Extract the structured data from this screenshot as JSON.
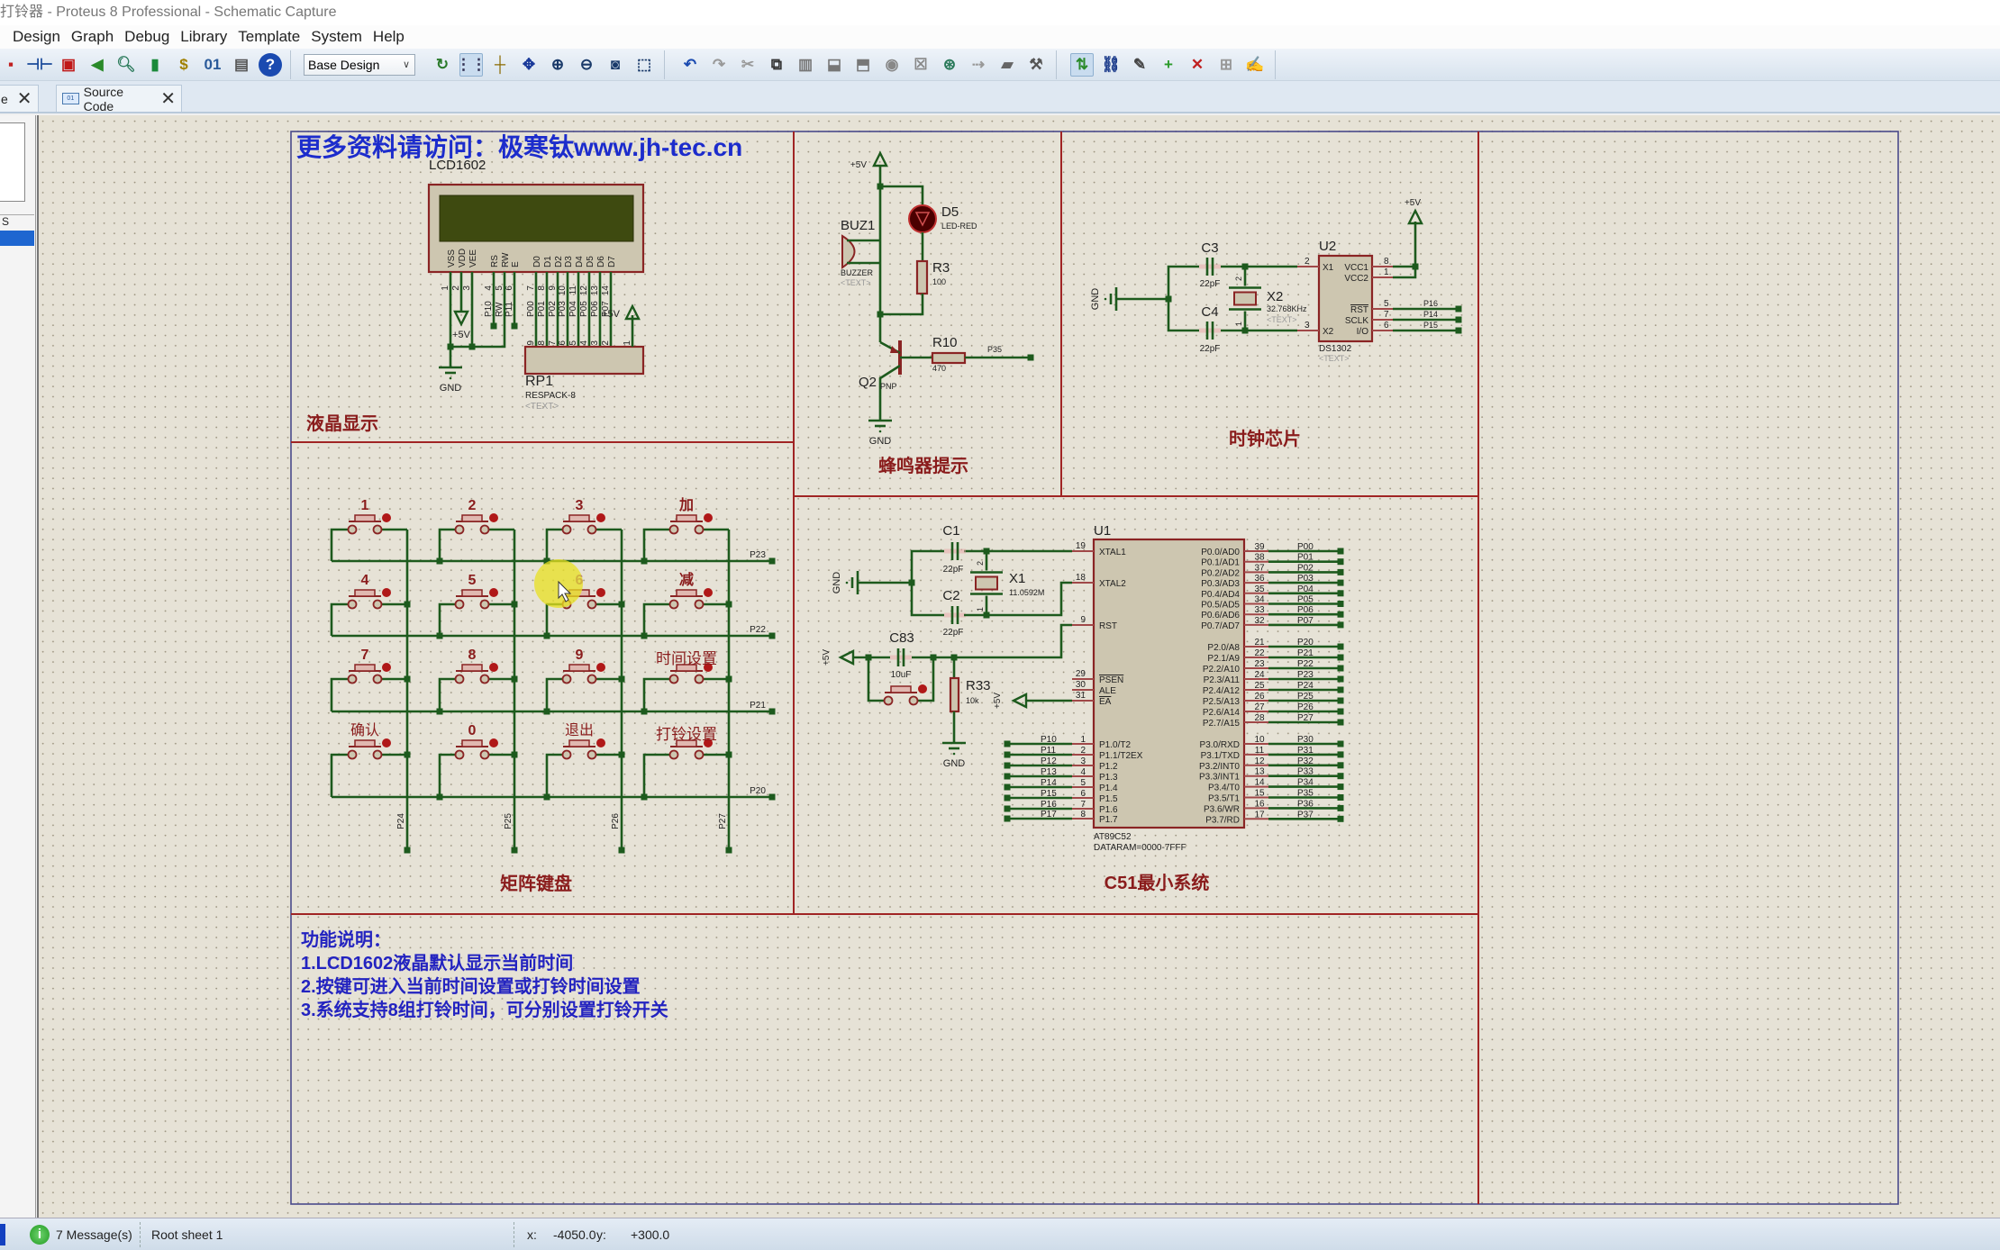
{
  "window": {
    "title": "打铃器 - Proteus 8 Professional - Schematic Capture"
  },
  "menu": [
    "Design",
    "Graph",
    "Debug",
    "Library",
    "Template",
    "System",
    "Help"
  ],
  "toolbar": {
    "groups": [
      [
        {
          "icon": "new-design-icon",
          "glyph": "▪",
          "color": "#c02020"
        },
        {
          "icon": "component-mode-icon",
          "glyph": "⊣⊢",
          "color": "#1a4a9a"
        },
        {
          "icon": "chip-icon",
          "glyph": "▣",
          "color": "#c01818"
        },
        {
          "icon": "back-icon",
          "glyph": "◀",
          "color": "#2a8a2a"
        },
        {
          "icon": "zoom-search-icon",
          "glyph": "🔍︎",
          "color": "#2a7a5a"
        },
        {
          "icon": "library-icon",
          "glyph": "▮",
          "color": "#1a8a3a"
        },
        {
          "icon": "bill-of-materials-icon",
          "glyph": "$",
          "color": "#a08000"
        },
        {
          "icon": "source-code-icon",
          "glyph": "01",
          "color": "#2a5a9a"
        },
        {
          "icon": "document-icon",
          "glyph": "▤",
          "color": "#555"
        },
        {
          "icon": "help-icon",
          "glyph": "?",
          "color": "#fff",
          "bg": "#1a4ab0"
        }
      ],
      [
        {
          "icon": "refresh-icon",
          "glyph": "↻",
          "color": "#2a7a2a"
        },
        {
          "icon": "grid-icon",
          "glyph": "⋮⋮",
          "color": "#335",
          "active": true
        },
        {
          "icon": "origin-icon",
          "glyph": "┼",
          "color": "#8a6a00"
        },
        {
          "icon": "pan-icon",
          "glyph": "✥",
          "color": "#1a3a9a"
        },
        {
          "icon": "zoom-in-icon",
          "glyph": "⊕",
          "color": "#1a3a6a"
        },
        {
          "icon": "zoom-out-icon",
          "glyph": "⊖",
          "color": "#1a3a6a"
        },
        {
          "icon": "zoom-all-icon",
          "glyph": "◙",
          "color": "#1a3a6a"
        },
        {
          "icon": "zoom-area-icon",
          "glyph": "⬚",
          "color": "#1a3a6a"
        }
      ],
      [
        {
          "icon": "undo-icon",
          "glyph": "↶",
          "color": "#1a4ab0"
        },
        {
          "icon": "redo-icon",
          "glyph": "↷",
          "color": "#999"
        },
        {
          "icon": "cut-icon",
          "glyph": "✂",
          "color": "#999"
        },
        {
          "icon": "copy-icon",
          "glyph": "⧉",
          "color": "#333"
        },
        {
          "icon": "paste-icon",
          "glyph": "▥",
          "color": "#777"
        },
        {
          "icon": "block-copy-icon",
          "glyph": "⬓",
          "color": "#777"
        },
        {
          "icon": "block-move-icon",
          "glyph": "⬒",
          "color": "#777"
        },
        {
          "icon": "block-rotate-icon",
          "glyph": "◉",
          "color": "#888"
        },
        {
          "icon": "block-delete-icon",
          "glyph": "☒",
          "color": "#888"
        },
        {
          "icon": "pick-device-icon",
          "glyph": "⊛",
          "color": "#2a7a5a"
        },
        {
          "icon": "make-device-icon",
          "glyph": "⇢",
          "color": "#999"
        },
        {
          "icon": "packaging-icon",
          "glyph": "▰",
          "color": "#666"
        },
        {
          "icon": "decompose-icon",
          "glyph": "⚒",
          "color": "#555"
        }
      ],
      [
        {
          "icon": "wire-autorouter-icon",
          "glyph": "⇅",
          "color": "#2a8a2a",
          "active": true
        },
        {
          "icon": "search-icon",
          "glyph": "⛓",
          "color": "#1a3a8a"
        },
        {
          "icon": "property-assign-icon",
          "glyph": "✎",
          "color": "#444"
        },
        {
          "icon": "new-sheet-icon",
          "glyph": "+",
          "color": "#2a9a2a"
        },
        {
          "icon": "remove-sheet-icon",
          "glyph": "✕",
          "color": "#c02020"
        },
        {
          "icon": "goto-parent-icon",
          "glyph": "⊞",
          "color": "#999"
        },
        {
          "icon": "design-notes-icon",
          "glyph": "✍",
          "color": "#1a3a9a"
        }
      ]
    ],
    "design_select": "Base Design"
  },
  "tabs": [
    {
      "label": "e"
    },
    {
      "label": "Source Code",
      "icon_text": "01"
    }
  ],
  "left_panel": {
    "item": "S"
  },
  "schematic": {
    "banner": "更多资料请访问：极寒钛www.jh-tec.cn",
    "lcd": {
      "section": "液晶显示",
      "ref": "LCD1602",
      "pins": [
        "VSS",
        "VDD",
        "VEE",
        "RS",
        "RW",
        "E",
        "D0",
        "D1",
        "D2",
        "D3",
        "D4",
        "D5",
        "D6",
        "D7"
      ],
      "pin_numbers": [
        "1",
        "2",
        "3",
        "4",
        "5",
        "6",
        "7",
        "8",
        "9",
        "10",
        "11",
        "12",
        "13",
        "14"
      ],
      "nets": [
        "",
        "",
        "",
        "P10",
        "RW",
        "P11",
        "P00",
        "P01",
        "P02",
        "P03",
        "P04",
        "P05",
        "P06",
        "P07"
      ],
      "rp_ref": "RP1",
      "rp_value": "RESPACK-8",
      "rp_text": "<TEXT>",
      "rp_pins": [
        "9",
        "8",
        "7",
        "6",
        "5",
        "4",
        "3",
        "2",
        "1"
      ],
      "gnd": "GND",
      "vcc": "+5V"
    },
    "buzzer": {
      "section": "蜂鸣器提示",
      "buz_ref": "BUZ1",
      "buz_value": "BUZZER",
      "buz_text": "<TEXT>",
      "led_ref": "D5",
      "led_value": "LED-RED",
      "r3_ref": "R3",
      "r3_value": "100",
      "q_ref": "Q2",
      "q_value": "PNP",
      "r10_ref": "R10",
      "r10_value": "470",
      "net": "P35",
      "vcc": "+5V",
      "gnd": "GND"
    },
    "clock": {
      "section": "时钟芯片",
      "ref": "U2",
      "value": "DS1302",
      "text": "<TEXT>",
      "left_pins": [
        {
          "name": "X1",
          "num": "2"
        },
        {
          "name": "X2",
          "num": "3"
        }
      ],
      "right_pins": [
        {
          "name": "VCC1",
          "num": "8",
          "net": ""
        },
        {
          "name": "VCC2",
          "num": "1",
          "net": ""
        },
        {
          "name": "RST",
          "num": "5",
          "net": "P16"
        },
        {
          "name": "SCLK",
          "num": "7",
          "net": "P14"
        },
        {
          "name": "I/O",
          "num": "6",
          "net": "P15"
        }
      ],
      "c3_ref": "C3",
      "c3_value": "22pF",
      "c4_ref": "C4",
      "c4_value": "22pF",
      "x2_ref": "X2",
      "x2_value": "32.768KHz",
      "x2_text": "<TEXT>",
      "x2_pin_a": "2",
      "x2_pin_b": "1",
      "gnd": "GND",
      "vcc": "+5V"
    },
    "keypad": {
      "section": "矩阵键盘",
      "keys": [
        [
          "1",
          "2",
          "3",
          "加"
        ],
        [
          "4",
          "5",
          "6",
          "减"
        ],
        [
          "7",
          "8",
          "9",
          "时间设置"
        ],
        [
          "确认",
          "0",
          "退出",
          "打铃设置"
        ]
      ],
      "rows": [
        "P23",
        "P22",
        "P21",
        "P20"
      ],
      "cols": [
        "P24",
        "P25",
        "P26",
        "P27"
      ]
    },
    "mcu": {
      "section": "C51最小系统",
      "ref": "U1",
      "value": "AT89C52",
      "dataram": "DATARAM=0000-7FFF",
      "left_pins": [
        {
          "name": "XTAL1",
          "num": "19"
        },
        {
          "name": "XTAL2",
          "num": "18"
        },
        {
          "name": "RST",
          "num": "9"
        },
        {
          "name": "PSEN",
          "num": "29"
        },
        {
          "name": "ALE",
          "num": "30"
        },
        {
          "name": "EA",
          "num": "31"
        }
      ],
      "p1_pins": [
        {
          "name": "P1.0/T2",
          "num": "1",
          "net": "P10"
        },
        {
          "name": "P1.1/T2EX",
          "num": "2",
          "net": "P11"
        },
        {
          "name": "P1.2",
          "num": "3",
          "net": "P12"
        },
        {
          "name": "P1.3",
          "num": "4",
          "net": "P13"
        },
        {
          "name": "P1.4",
          "num": "5",
          "net": "P14"
        },
        {
          "name": "P1.5",
          "num": "6",
          "net": "P15"
        },
        {
          "name": "P1.6",
          "num": "7",
          "net": "P16"
        },
        {
          "name": "P1.7",
          "num": "8",
          "net": "P17"
        }
      ],
      "p0_pins": [
        {
          "name": "P0.0/AD0",
          "num": "39",
          "net": "P00"
        },
        {
          "name": "P0.1/AD1",
          "num": "38",
          "net": "P01"
        },
        {
          "name": "P0.2/AD2",
          "num": "37",
          "net": "P02"
        },
        {
          "name": "P0.3/AD3",
          "num": "36",
          "net": "P03"
        },
        {
          "name": "P0.4/AD4",
          "num": "35",
          "net": "P04"
        },
        {
          "name": "P0.5/AD5",
          "num": "34",
          "net": "P05"
        },
        {
          "name": "P0.6/AD6",
          "num": "33",
          "net": "P06"
        },
        {
          "name": "P0.7/AD7",
          "num": "32",
          "net": "P07"
        }
      ],
      "p2_pins": [
        {
          "name": "P2.0/A8",
          "num": "21",
          "net": "P20"
        },
        {
          "name": "P2.1/A9",
          "num": "22",
          "net": "P21"
        },
        {
          "name": "P2.2/A10",
          "num": "23",
          "net": "P22"
        },
        {
          "name": "P2.3/A11",
          "num": "24",
          "net": "P23"
        },
        {
          "name": "P2.4/A12",
          "num": "25",
          "net": "P24"
        },
        {
          "name": "P2.5/A13",
          "num": "26",
          "net": "P25"
        },
        {
          "name": "P2.6/A14",
          "num": "27",
          "net": "P26"
        },
        {
          "name": "P2.7/A15",
          "num": "28",
          "net": "P27"
        }
      ],
      "p3_pins": [
        {
          "name": "P3.0/RXD",
          "num": "10",
          "net": "P30"
        },
        {
          "name": "P3.1/TXD",
          "num": "11",
          "net": "P31"
        },
        {
          "name": "P3.2/INT0",
          "num": "12",
          "net": "P32"
        },
        {
          "name": "P3.3/INT1",
          "num": "13",
          "net": "P33"
        },
        {
          "name": "P3.4/T0",
          "num": "14",
          "net": "P34"
        },
        {
          "name": "P3.5/T1",
          "num": "15",
          "net": "P35"
        },
        {
          "name": "P3.6/WR",
          "num": "16",
          "net": "P36"
        },
        {
          "name": "P3.7/RD",
          "num": "17",
          "net": "P37"
        }
      ],
      "c1_ref": "C1",
      "c1_value": "22pF",
      "c2_ref": "C2",
      "c2_value": "22pF",
      "x1_ref": "X1",
      "x1_value": "11.0592M",
      "x1_pin_a": "2",
      "x1_pin_b": "1",
      "c83_ref": "C83",
      "c83_value": "10uF",
      "r33_ref": "R33",
      "r33_value": "10k",
      "gnd": "GND",
      "vcc": "+5V"
    },
    "description": {
      "title": "功能说明：",
      "lines": [
        "1.LCD1602液晶默认显示当前时间",
        "2.按键可进入当前时间设置或打铃时间设置",
        "3.系统支持8组打铃时间，可分别设置打铃开关"
      ]
    }
  },
  "status": {
    "info_icon": "i",
    "messages": "7 Message(s)",
    "sheet": "Root sheet 1",
    "x_label": "x:",
    "x": "-4050.0",
    "y_label": "y:",
    "y": "+300.0"
  },
  "colors": {
    "wire": "#1d5a1d",
    "component_border": "#8a2424",
    "component_fill": "#cdc6b0",
    "canvas": "#e6e2d6",
    "section_text": "#8a1c1c",
    "note_text": "#2323c0",
    "lcd_screen": "#3e4a10"
  }
}
